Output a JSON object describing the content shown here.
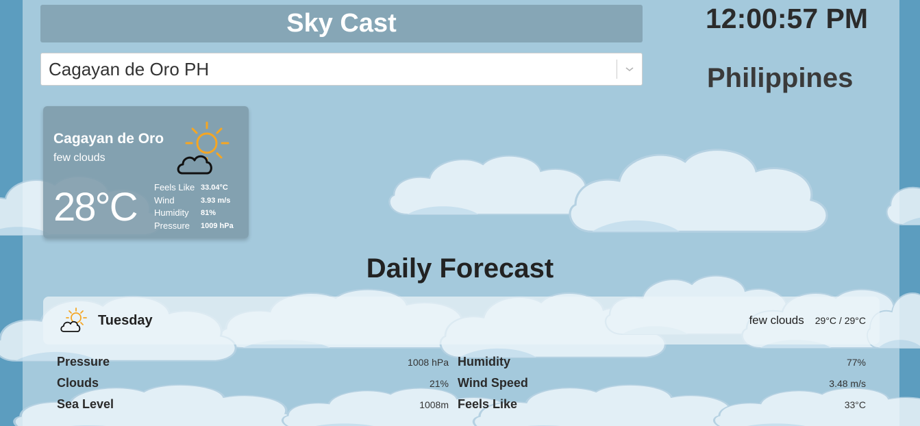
{
  "app": {
    "title": "Sky Cast"
  },
  "search": {
    "selected": "Cagayan de Oro PH"
  },
  "clock": {
    "time": "12:00:57 PM"
  },
  "country": "Philippines",
  "current": {
    "city": "Cagayan de Oro",
    "description": "few clouds",
    "temperature": "28°C",
    "icon": "partly-cloudy-sun-icon",
    "details": [
      {
        "label": "Feels Like",
        "value": "33.04°C"
      },
      {
        "label": "Wind",
        "value": "3.93 m/s"
      },
      {
        "label": "Humidity",
        "value": "81%"
      },
      {
        "label": "Pressure",
        "value": "1009 hPa"
      }
    ]
  },
  "daily": {
    "heading": "Daily Forecast",
    "days": [
      {
        "name": "Tuesday",
        "description": "few clouds",
        "temp_range": "29°C / 29°C",
        "icon": "partly-cloudy-sun-icon",
        "details_left": [
          {
            "label": "Pressure",
            "value": "1008 hPa"
          },
          {
            "label": "Clouds",
            "value": "21%"
          },
          {
            "label": "Sea Level",
            "value": "1008m"
          }
        ],
        "details_right": [
          {
            "label": "Humidity",
            "value": "77%"
          },
          {
            "label": "Wind Speed",
            "value": "3.48 m/s"
          },
          {
            "label": "Feels Like",
            "value": "33°C"
          }
        ]
      }
    ]
  },
  "colors": {
    "background": "#a4c9dc",
    "title_bar": "#86a6b6",
    "sun": "#f5a623",
    "card": "#7e9baa"
  }
}
